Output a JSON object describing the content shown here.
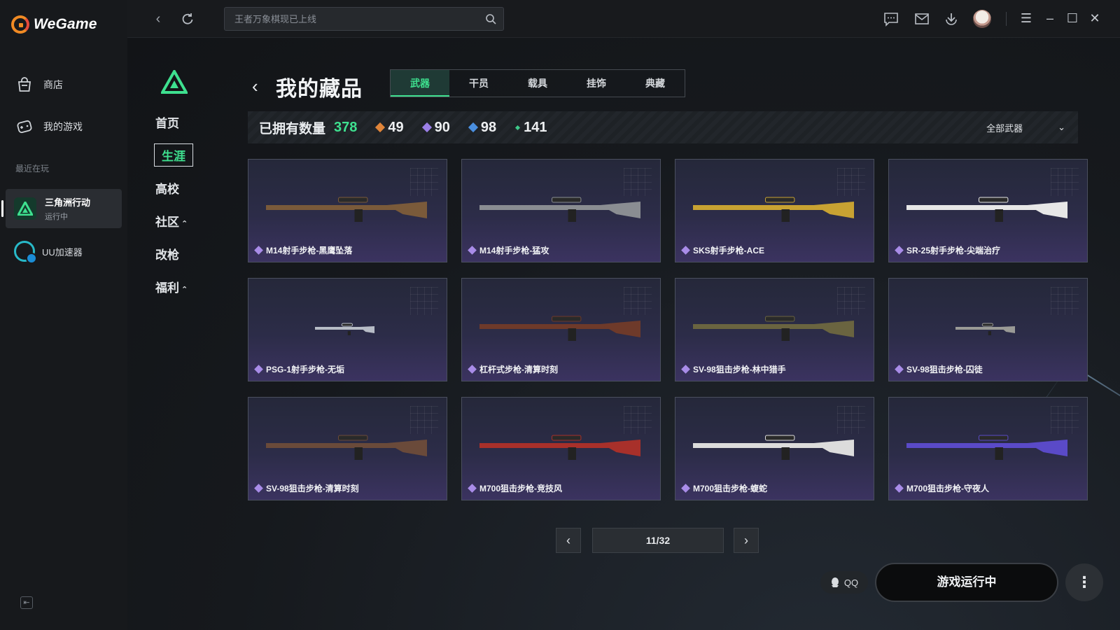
{
  "app": {
    "name": "WeGame"
  },
  "sidebar": {
    "items": [
      {
        "label": "商店",
        "icon": "shop-bag-icon"
      },
      {
        "label": "我的游戏",
        "icon": "gamepad-icon"
      }
    ],
    "recent_label": "最近在玩",
    "recent_game": {
      "name": "三角洲行动",
      "status": "运行中"
    },
    "uu": {
      "label": "UU加速器"
    }
  },
  "topbar": {
    "search_placeholder": "王者万象棋现已上线",
    "icons": [
      "back-icon",
      "refresh-icon",
      "search-icon",
      "message-icon",
      "mail-icon",
      "download-icon",
      "avatar",
      "menu-icon",
      "minimize-icon",
      "maximize-icon",
      "close-icon"
    ]
  },
  "game_nav": {
    "items": [
      "首页",
      "生涯",
      "高校",
      "社区",
      "改枪",
      "福利"
    ],
    "active": "生涯",
    "expand_marker": "⌃"
  },
  "collection": {
    "title": "我的藏品",
    "tabs": [
      "武器",
      "干员",
      "载具",
      "挂饰",
      "典藏"
    ],
    "active_tab": "武器",
    "owned_label": "已拥有数量",
    "owned_total": "378",
    "rarity_counts": [
      {
        "value": "49",
        "color": "#e0853a"
      },
      {
        "value": "90",
        "color": "#9b7fe6"
      },
      {
        "value": "98",
        "color": "#4a8fe0"
      },
      {
        "value": "141",
        "color": "#3ec98a"
      }
    ],
    "filter_label": "全部武器",
    "items": [
      {
        "name": "M14射手步枪-黑鹰坠落",
        "color": "#7a5a3a"
      },
      {
        "name": "M14射手步枪-猛攻",
        "color": "#8a8d92"
      },
      {
        "name": "SKS射手步枪-ACE",
        "color": "#c8a232"
      },
      {
        "name": "SR-25射手步枪-尖端治疗",
        "color": "#e7e7e7"
      },
      {
        "name": "PSG-1射手步枪-无垢",
        "color": "#b7bcc6"
      },
      {
        "name": "杠杆式步枪-清算时刻",
        "color": "#6e3a2a"
      },
      {
        "name": "SV-98狙击步枪-林中猎手",
        "color": "#6a6440"
      },
      {
        "name": "SV-98狙击步枪-囚徒",
        "color": "#9a9a96"
      },
      {
        "name": "SV-98狙击步枪-清算时刻",
        "color": "#6a4a3a"
      },
      {
        "name": "M700狙击步枪-竞技风",
        "color": "#a8302a"
      },
      {
        "name": "M700狙击步枪-蝮蛇",
        "color": "#dcdcdc"
      },
      {
        "name": "M700狙击步枪-守夜人",
        "color": "#5a4ac8"
      }
    ]
  },
  "pager": {
    "current": "11/32"
  },
  "bottom": {
    "qq_label": "QQ",
    "run_label": "游戏运行中",
    "more_label": "⋮"
  },
  "colors": {
    "accent": "#3ee08f",
    "brand": "#f08a24"
  }
}
